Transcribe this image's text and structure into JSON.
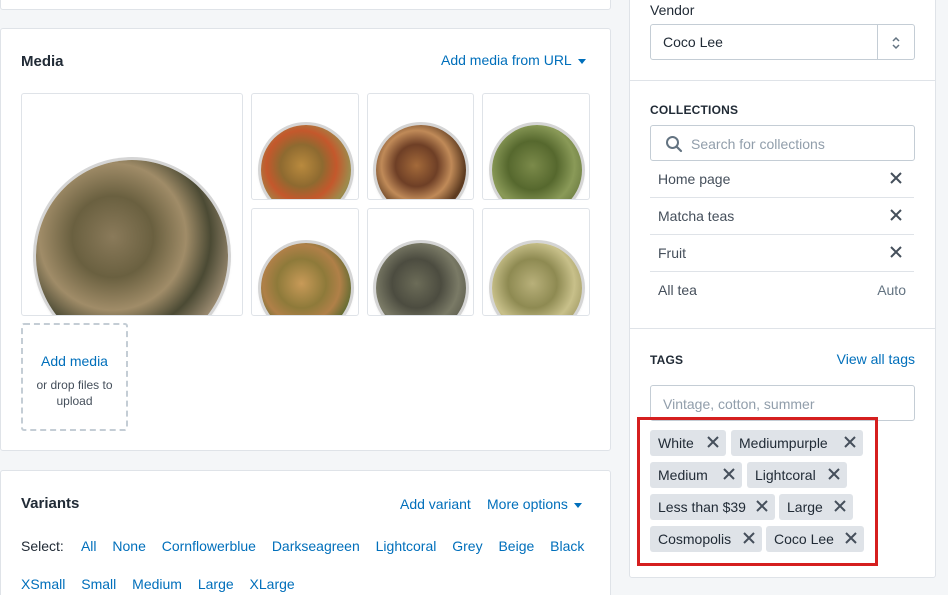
{
  "media": {
    "title": "Media",
    "add_from_url": "Add media from URL",
    "add_media": "Add media",
    "drop_hint": "or drop files to upload"
  },
  "variants": {
    "title": "Variants",
    "add_variant": "Add variant",
    "more_options": "More options",
    "select_label": "Select:",
    "select_options_row1": [
      "All",
      "None",
      "Cornflowerblue",
      "Darkseagreen",
      "Lightcoral",
      "Grey",
      "Beige",
      "Black"
    ],
    "select_options_row2": [
      "XSmall",
      "Small",
      "Medium",
      "Large",
      "XLarge"
    ]
  },
  "vendor": {
    "label": "Vendor",
    "value": "Coco Lee"
  },
  "collections": {
    "label": "COLLECTIONS",
    "search_placeholder": "Search for collections",
    "items": [
      {
        "name": "Home page",
        "removable": true
      },
      {
        "name": "Matcha teas",
        "removable": true
      },
      {
        "name": "Fruit",
        "removable": true
      },
      {
        "name": "All tea",
        "status": "Auto"
      }
    ]
  },
  "tags": {
    "label": "TAGS",
    "view_all": "View all tags",
    "input_placeholder": "Vintage, cotton, summer",
    "items": [
      "White",
      "Mediumpurple",
      "Medium",
      "Lightcoral",
      "Less than $39",
      "Large",
      "Cosmopolis",
      "Coco Lee"
    ]
  },
  "colors": {
    "link": "#006fbb",
    "highlight_border": "#d51f1f",
    "tag_bg": "#dfe3e8",
    "page_bg": "#f4f6f8"
  }
}
